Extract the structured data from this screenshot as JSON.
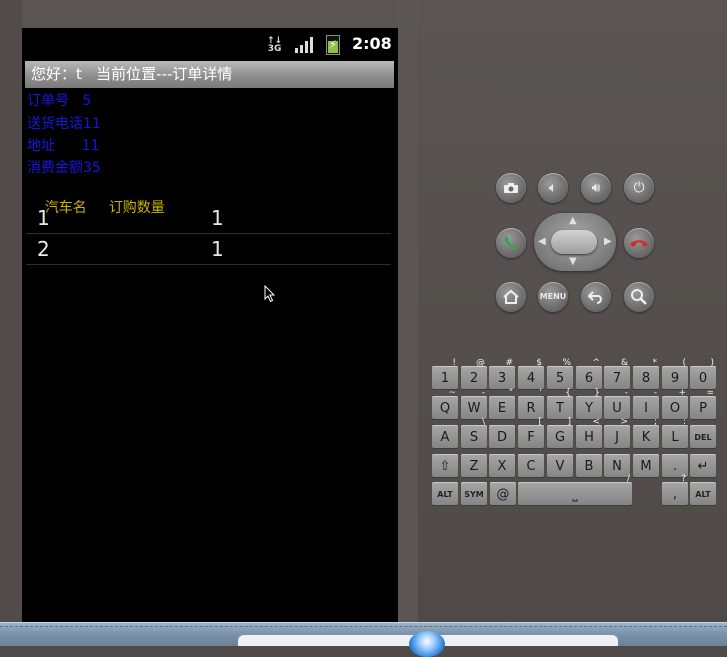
{
  "status_bar": {
    "network": "3G",
    "time": "2:08",
    "battery_color": "#8bc34a"
  },
  "title_bar": {
    "text": "您好：t   当前位置---订单详情"
  },
  "order_info": {
    "order_no": "订单号   5",
    "phone": "送货电话11",
    "address": "地址      11",
    "amount": "消费金额35"
  },
  "list_header": {
    "car_name": "汽车名",
    "quantity": "订购数量"
  },
  "rows": [
    {
      "name": "1",
      "qty": "1"
    },
    {
      "name": "2",
      "qty": "1"
    }
  ],
  "controls": {
    "camera_icon": "camera-icon",
    "volume_down_icon": "volume-down-icon",
    "volume_up_icon": "volume-up-icon",
    "power_icon": "power-icon",
    "call_icon": "call-icon",
    "end_call_icon": "end-call-icon",
    "home_icon": "home-icon",
    "menu_label": "MENU",
    "back_icon": "back-icon",
    "search_icon": "search-icon"
  },
  "keyboard": {
    "row1": [
      {
        "k": "1",
        "a": "!"
      },
      {
        "k": "2",
        "a": "@"
      },
      {
        "k": "3",
        "a": "#"
      },
      {
        "k": "4",
        "a": "$"
      },
      {
        "k": "5",
        "a": "%"
      },
      {
        "k": "6",
        "a": "^"
      },
      {
        "k": "7",
        "a": "&"
      },
      {
        "k": "8",
        "a": "*"
      },
      {
        "k": "9",
        "a": "("
      },
      {
        "k": "0",
        "a": ")"
      }
    ],
    "row2": [
      {
        "k": "Q",
        "a": "~"
      },
      {
        "k": "W",
        "a": "-"
      },
      {
        "k": "E",
        "a": "\""
      },
      {
        "k": "R",
        "a": "'"
      },
      {
        "k": "T",
        "a": "{"
      },
      {
        "k": "Y",
        "a": "}"
      },
      {
        "k": "U",
        "a": "-"
      },
      {
        "k": "I",
        "a": "-"
      },
      {
        "k": "O",
        "a": "+"
      },
      {
        "k": "P",
        "a": "="
      }
    ],
    "row3": [
      {
        "k": "A",
        "a": ""
      },
      {
        "k": "S",
        "a": "\\"
      },
      {
        "k": "D",
        "a": ""
      },
      {
        "k": "F",
        "a": "["
      },
      {
        "k": "G",
        "a": "]"
      },
      {
        "k": "H",
        "a": "<"
      },
      {
        "k": "J",
        "a": ">"
      },
      {
        "k": "K",
        "a": ";"
      },
      {
        "k": "L",
        "a": ":"
      },
      {
        "k": "DEL",
        "a": ""
      }
    ],
    "row4": [
      {
        "k": "⇧",
        "a": ""
      },
      {
        "k": "Z",
        "a": ""
      },
      {
        "k": "X",
        "a": ""
      },
      {
        "k": "C",
        "a": ""
      },
      {
        "k": "V",
        "a": ""
      },
      {
        "k": "B",
        "a": ""
      },
      {
        "k": "N",
        "a": ""
      },
      {
        "k": "M",
        "a": ""
      },
      {
        "k": ".",
        "a": ""
      },
      {
        "k": "↵",
        "a": ""
      }
    ],
    "row5": {
      "alt_left": "ALT",
      "sym": "SYM",
      "at": "@",
      "space": "⎵",
      "slash": "/",
      "question": "?",
      "comma": ",",
      "alt_right": "ALT"
    }
  }
}
